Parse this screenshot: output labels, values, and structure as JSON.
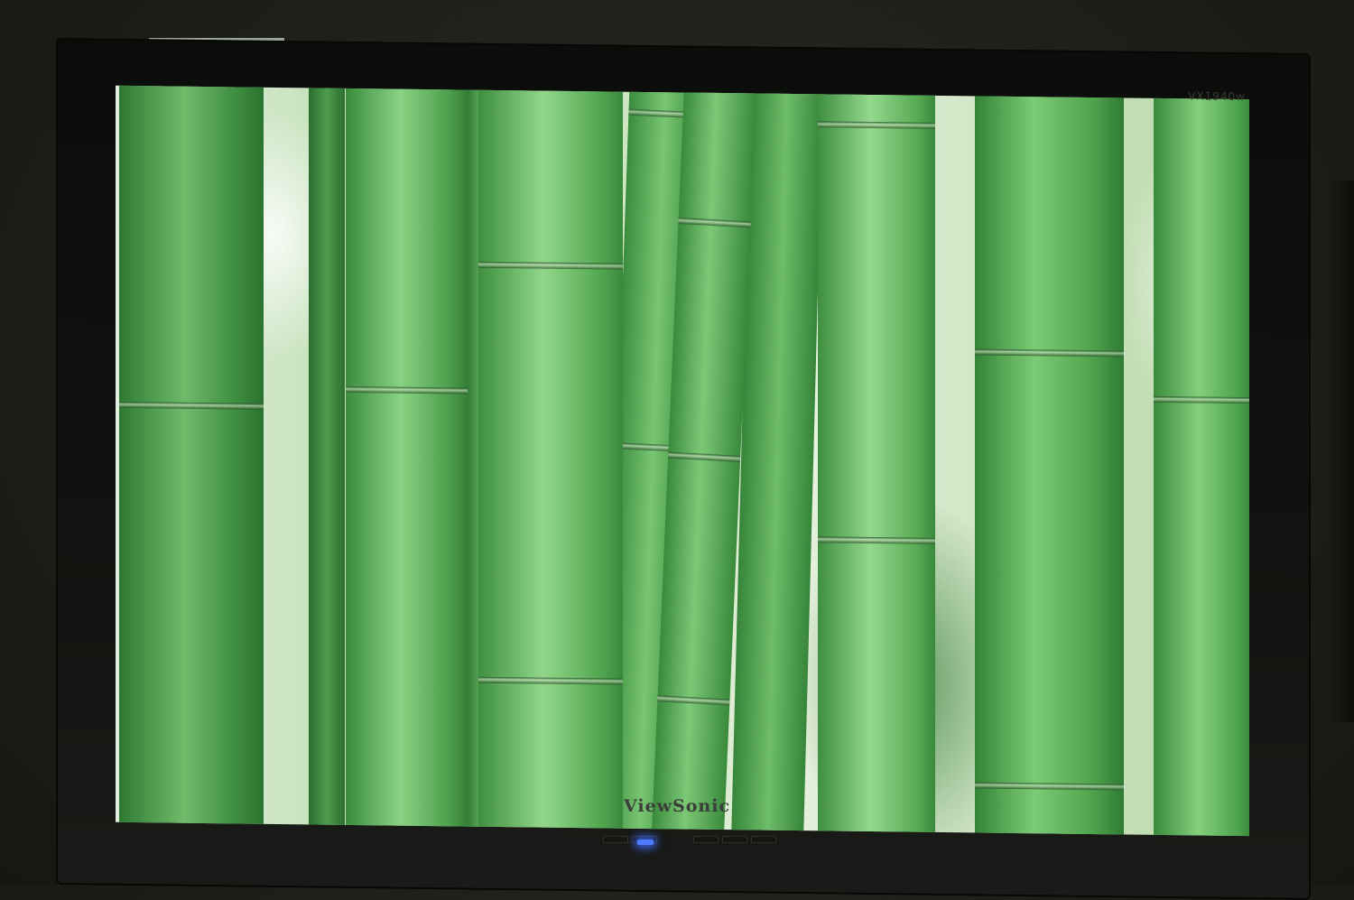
{
  "monitor": {
    "brand": "ViewSonic",
    "corner_label": "VX1940w",
    "power_led_color": "#4f7bff"
  },
  "screen": {
    "subject": "bamboo-forest-wallpaper",
    "colors": {
      "culm_light": "#7cc977",
      "culm_mid": "#4faa4e",
      "culm_dark": "#2d7d35",
      "background_light": "#e4f0de"
    }
  }
}
